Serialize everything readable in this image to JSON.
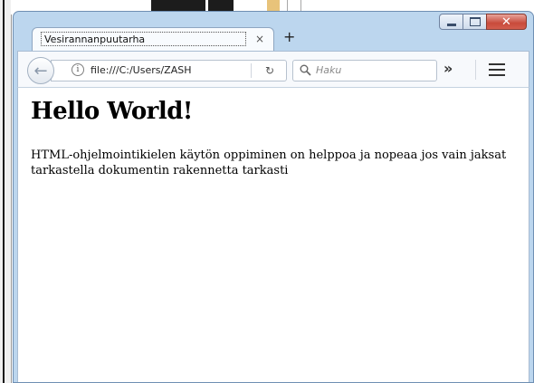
{
  "browser": {
    "tab": {
      "title": "Vesirannanpuutarha",
      "close_glyph": "×"
    },
    "new_tab_glyph": "+",
    "window_controls": {
      "minimize_icon": "minimize-icon",
      "maximize_icon": "maximize-icon",
      "close_glyph": "✕"
    },
    "toolbar": {
      "back_glyph": "←",
      "info_glyph": "i",
      "url": "file:///C:/Users/ZASH",
      "reload_glyph": "↻",
      "search_placeholder": "Haku",
      "overflow_glyph": "»"
    }
  },
  "page": {
    "heading": "Hello World!",
    "paragraph": "HTML-ohjelmointikielen käytön oppiminen on helppoa ja nopeaa jos vain jaksat tarkastella dokumentin rakennetta tarkasti"
  },
  "colors": {
    "window_frame": "#bcd6ee",
    "close_button": "#c84a3b",
    "toolbar": "#f7f9fc"
  }
}
